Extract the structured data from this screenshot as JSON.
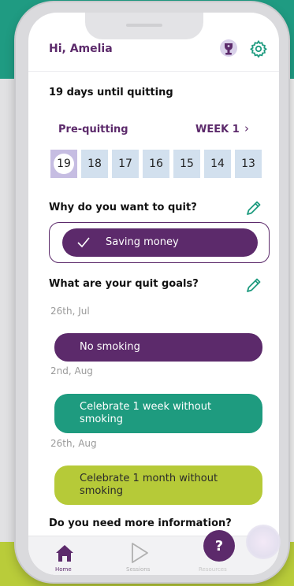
{
  "header": {
    "greeting": "Hi, Amelia",
    "icons": [
      "trophy-icon",
      "settings-gear-icon"
    ]
  },
  "countdown": {
    "text": "19 days until quitting"
  },
  "phase": {
    "label": "Pre-quitting",
    "week_label": "WEEK 1",
    "next_icon": "chevron-right-icon"
  },
  "days": [
    "19",
    "18",
    "17",
    "16",
    "15",
    "14",
    "13"
  ],
  "why": {
    "heading": "Why do you want to quit?",
    "selected_reason": "Saving money",
    "edit_icon": "pencil-icon"
  },
  "goals": {
    "heading": "What are your quit goals?",
    "edit_icon": "pencil-icon",
    "items": [
      {
        "date": "26th, Jul",
        "text": "No smoking"
      },
      {
        "date": "2nd, Aug",
        "text": "Celebrate 1 week without smoking"
      },
      {
        "date": "26th, Aug",
        "text": "Celebrate 1 month without smoking"
      }
    ]
  },
  "info": {
    "heading": "Do you need more information?"
  },
  "nav": {
    "home": "Home",
    "sessions": "Sessions",
    "resources": "Resources",
    "help_label": "?"
  },
  "colors": {
    "primary": "#5c2a6b",
    "teal": "#1e9b7f",
    "lime": "#b6ca38",
    "day_bg": "#d2e0ee",
    "day_active": "#c6bde2"
  }
}
